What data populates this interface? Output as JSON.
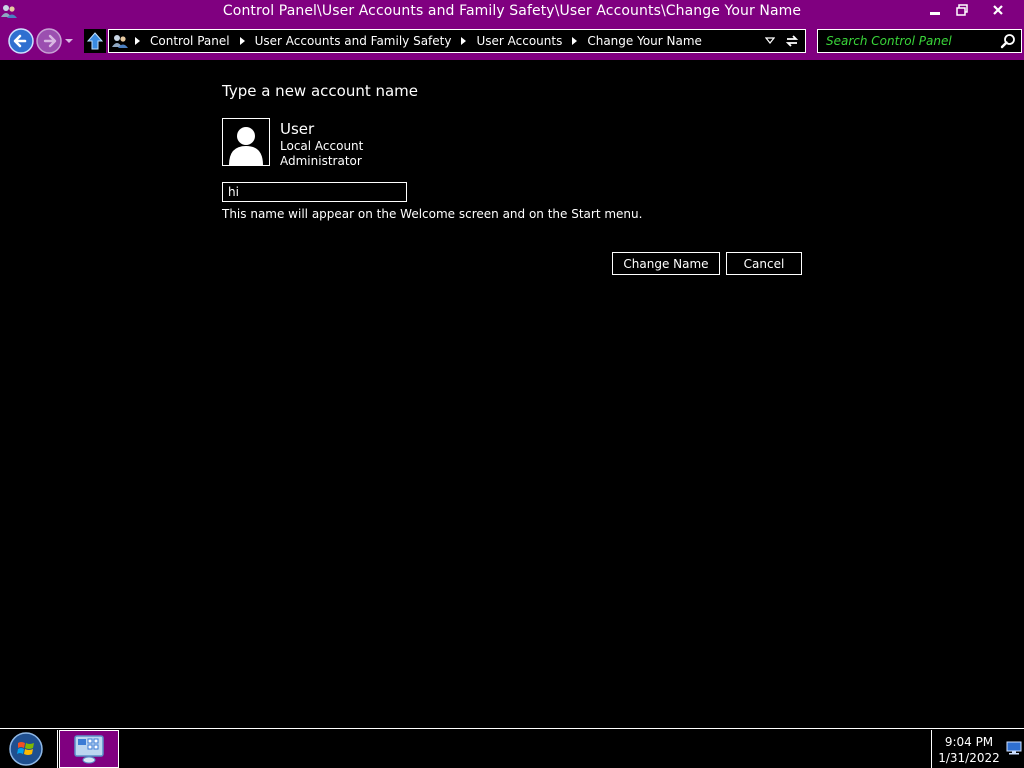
{
  "window": {
    "title": "Control Panel\\User Accounts and Family Safety\\User Accounts\\Change Your Name",
    "app_icon": "user-accounts-icon",
    "minimize_icon": "minimize-icon",
    "maximize_icon": "restore-icon",
    "close_icon": "close-icon"
  },
  "nav": {
    "back_icon": "back-arrow-icon",
    "forward_icon": "forward-arrow-icon",
    "up_icon": "up-arrow-icon",
    "breadcrumbs": [
      "Control Panel",
      "User Accounts and Family Safety",
      "User Accounts",
      "Change Your Name"
    ],
    "search_placeholder": "Search Control Panel"
  },
  "content": {
    "heading": "Type a new account name",
    "user": {
      "name": "User",
      "type": "Local Account",
      "role": "Administrator"
    },
    "name_input_value": "hi",
    "hint": "This name will appear on the Welcome screen and on the Start menu.",
    "change_button": "Change Name",
    "cancel_button": "Cancel"
  },
  "taskbar": {
    "time": "9:04 PM",
    "date": "1/31/2022"
  },
  "colors": {
    "accent": "#800080",
    "background": "#000000",
    "foreground": "#ffffff",
    "search_text": "#3ad63a"
  }
}
